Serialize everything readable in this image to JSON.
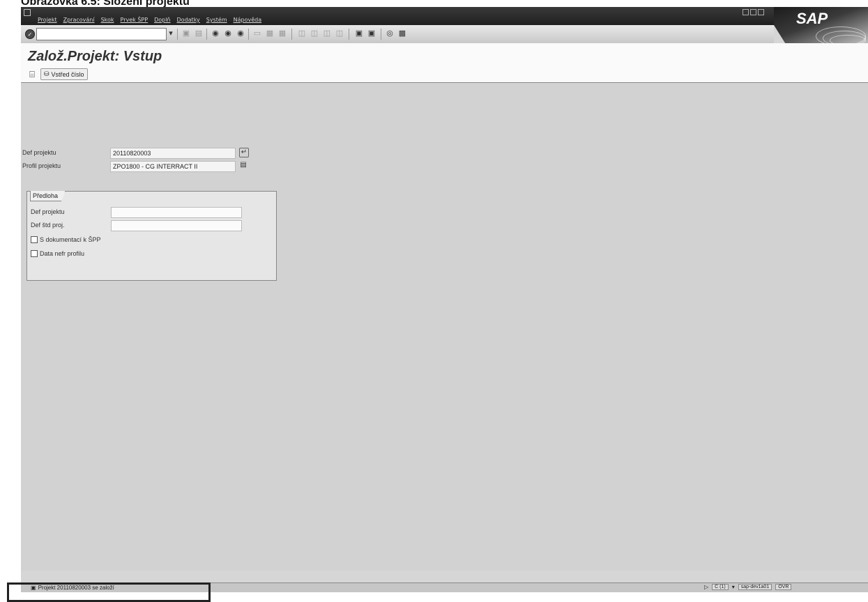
{
  "doc_caption": "Obrazovka 6.5: Složení projektu",
  "menu": {
    "items": [
      "Projekt",
      "Zpracování",
      "Skok",
      "Prvek ŠPP",
      "Doplň",
      "Dodatky",
      "Systém",
      "Nápověda"
    ]
  },
  "brand": {
    "logo": "SAP"
  },
  "screen": {
    "title": "Založ.Projekt: Vstup",
    "app_button_label": "Vstřed číslo"
  },
  "form": {
    "project_def_label": "Def projektu",
    "project_def_value": "20110820003",
    "project_profile_label": "Profil projektu",
    "project_profile_value": "ZPO1800 - CG INTERRACT II"
  },
  "template_group": {
    "title": "Předloha",
    "def_project_label": "Def projektu",
    "def_standard_label": "Def štd proj.",
    "def_project_value": "",
    "def_standard_value": "",
    "checkbox_docs_label": "S dokumentací k ŠPP",
    "checkbox_profile_label": "Data nefr profilu"
  },
  "status_bar": {
    "message": "Projekt 20110820003 se založí",
    "client": "C (1)",
    "server": "sap-dev1a01",
    "mode": "OVR"
  },
  "icons": {
    "enter": "enter-icon",
    "save": "save-icon",
    "back": "back-icon",
    "exit": "exit-icon",
    "cancel": "cancel-icon",
    "print": "print-icon",
    "find": "find-icon",
    "help": "help-icon"
  }
}
